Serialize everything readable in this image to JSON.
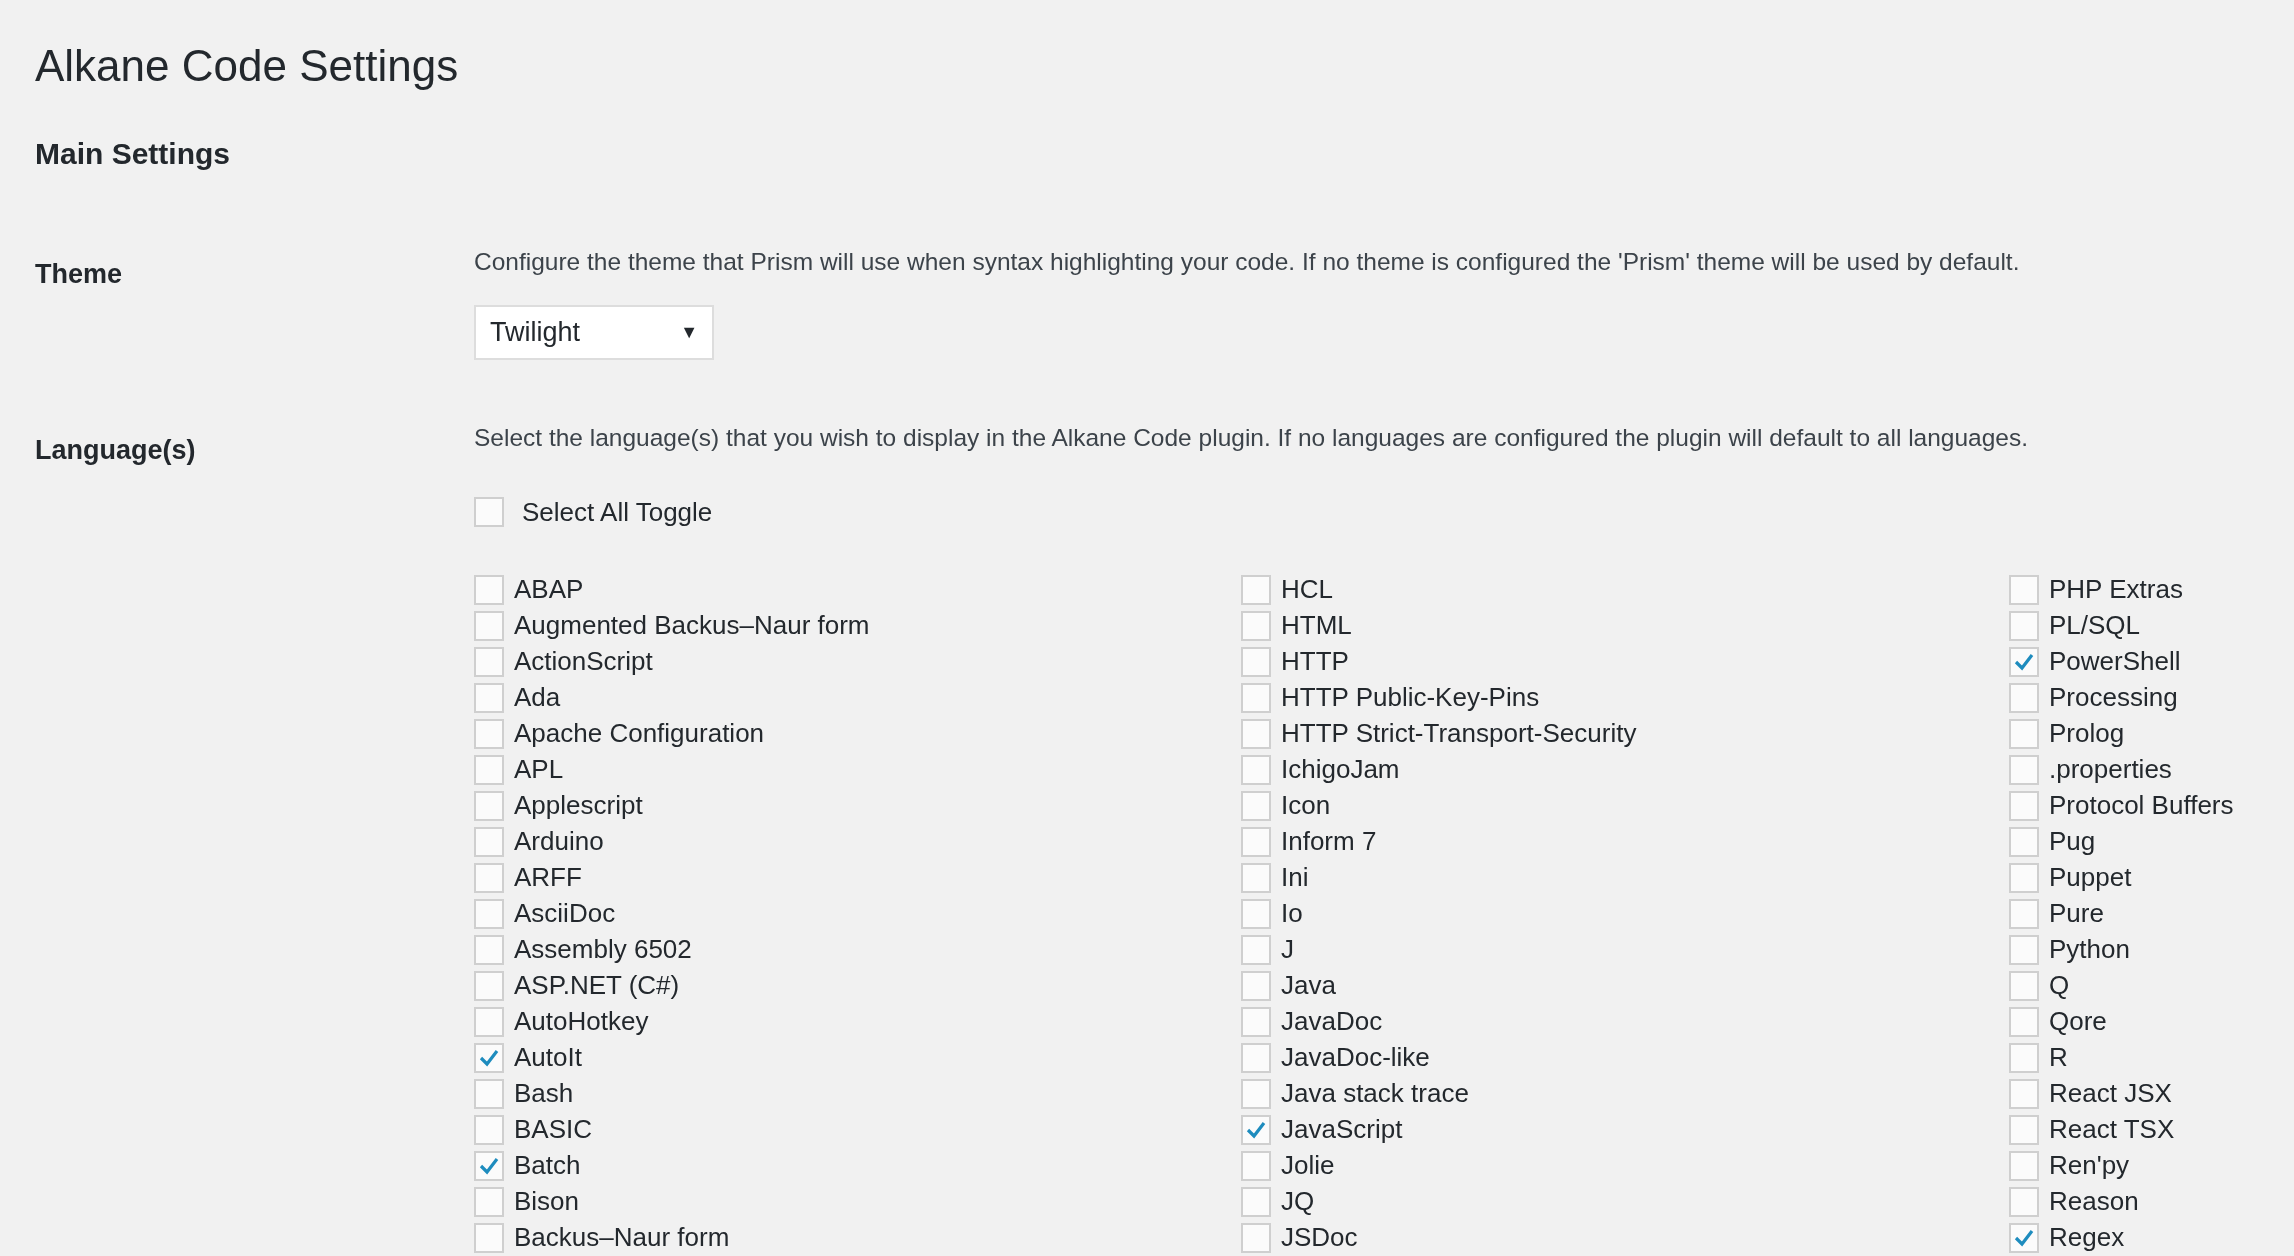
{
  "page_title": "Alkane Code Settings",
  "section_title": "Main Settings",
  "theme": {
    "label": "Theme",
    "description": "Configure the theme that Prism will use when syntax highlighting your code. If no theme is configured the 'Prism' theme will be used by default.",
    "select": {
      "value": "Twilight",
      "caret": "▼"
    }
  },
  "languages": {
    "label": "Language(s)",
    "description": "Select the language(s) that you wish to display in the Alkane Code plugin. If no languages are configured the plugin will default to all languages.",
    "select_all": {
      "label": "Select All Toggle",
      "checked": false
    },
    "columns": [
      [
        {
          "label": "ABAP",
          "checked": false
        },
        {
          "label": "Augmented Backus–Naur form",
          "checked": false
        },
        {
          "label": "ActionScript",
          "checked": false
        },
        {
          "label": "Ada",
          "checked": false
        },
        {
          "label": "Apache Configuration",
          "checked": false
        },
        {
          "label": "APL",
          "checked": false
        },
        {
          "label": "Applescript",
          "checked": false
        },
        {
          "label": "Arduino",
          "checked": false
        },
        {
          "label": "ARFF",
          "checked": false
        },
        {
          "label": "AsciiDoc",
          "checked": false
        },
        {
          "label": "Assembly 6502",
          "checked": false
        },
        {
          "label": "ASP.NET (C#)",
          "checked": false
        },
        {
          "label": "AutoHotkey",
          "checked": false
        },
        {
          "label": "AutoIt",
          "checked": true
        },
        {
          "label": "Bash",
          "checked": false
        },
        {
          "label": "BASIC",
          "checked": false
        },
        {
          "label": "Batch",
          "checked": true
        },
        {
          "label": "Bison",
          "checked": false
        },
        {
          "label": "Backus–Naur form",
          "checked": false
        }
      ],
      [
        {
          "label": "HCL",
          "checked": false
        },
        {
          "label": "HTML",
          "checked": false
        },
        {
          "label": "HTTP",
          "checked": false
        },
        {
          "label": "HTTP Public-Key-Pins",
          "checked": false
        },
        {
          "label": "HTTP Strict-Transport-Security",
          "checked": false
        },
        {
          "label": "IchigoJam",
          "checked": false
        },
        {
          "label": "Icon",
          "checked": false
        },
        {
          "label": "Inform 7",
          "checked": false
        },
        {
          "label": "Ini",
          "checked": false
        },
        {
          "label": "Io",
          "checked": false
        },
        {
          "label": "J",
          "checked": false
        },
        {
          "label": "Java",
          "checked": false
        },
        {
          "label": "JavaDoc",
          "checked": false
        },
        {
          "label": "JavaDoc-like",
          "checked": false
        },
        {
          "label": "Java stack trace",
          "checked": false
        },
        {
          "label": "JavaScript",
          "checked": true
        },
        {
          "label": "Jolie",
          "checked": false
        },
        {
          "label": "JQ",
          "checked": false
        },
        {
          "label": "JSDoc",
          "checked": false
        }
      ],
      [
        {
          "label": "PHP Extras",
          "checked": false
        },
        {
          "label": "PL/SQL",
          "checked": false
        },
        {
          "label": "PowerShell",
          "checked": true
        },
        {
          "label": "Processing",
          "checked": false
        },
        {
          "label": "Prolog",
          "checked": false
        },
        {
          "label": ".properties",
          "checked": false
        },
        {
          "label": "Protocol Buffers",
          "checked": false
        },
        {
          "label": "Pug",
          "checked": false
        },
        {
          "label": "Puppet",
          "checked": false
        },
        {
          "label": "Pure",
          "checked": false
        },
        {
          "label": "Python",
          "checked": false
        },
        {
          "label": "Q",
          "checked": false
        },
        {
          "label": "Qore",
          "checked": false
        },
        {
          "label": "R",
          "checked": false
        },
        {
          "label": "React JSX",
          "checked": false
        },
        {
          "label": "React TSX",
          "checked": false
        },
        {
          "label": "Ren'py",
          "checked": false
        },
        {
          "label": "Reason",
          "checked": false
        },
        {
          "label": "Regex",
          "checked": true
        }
      ]
    ]
  }
}
